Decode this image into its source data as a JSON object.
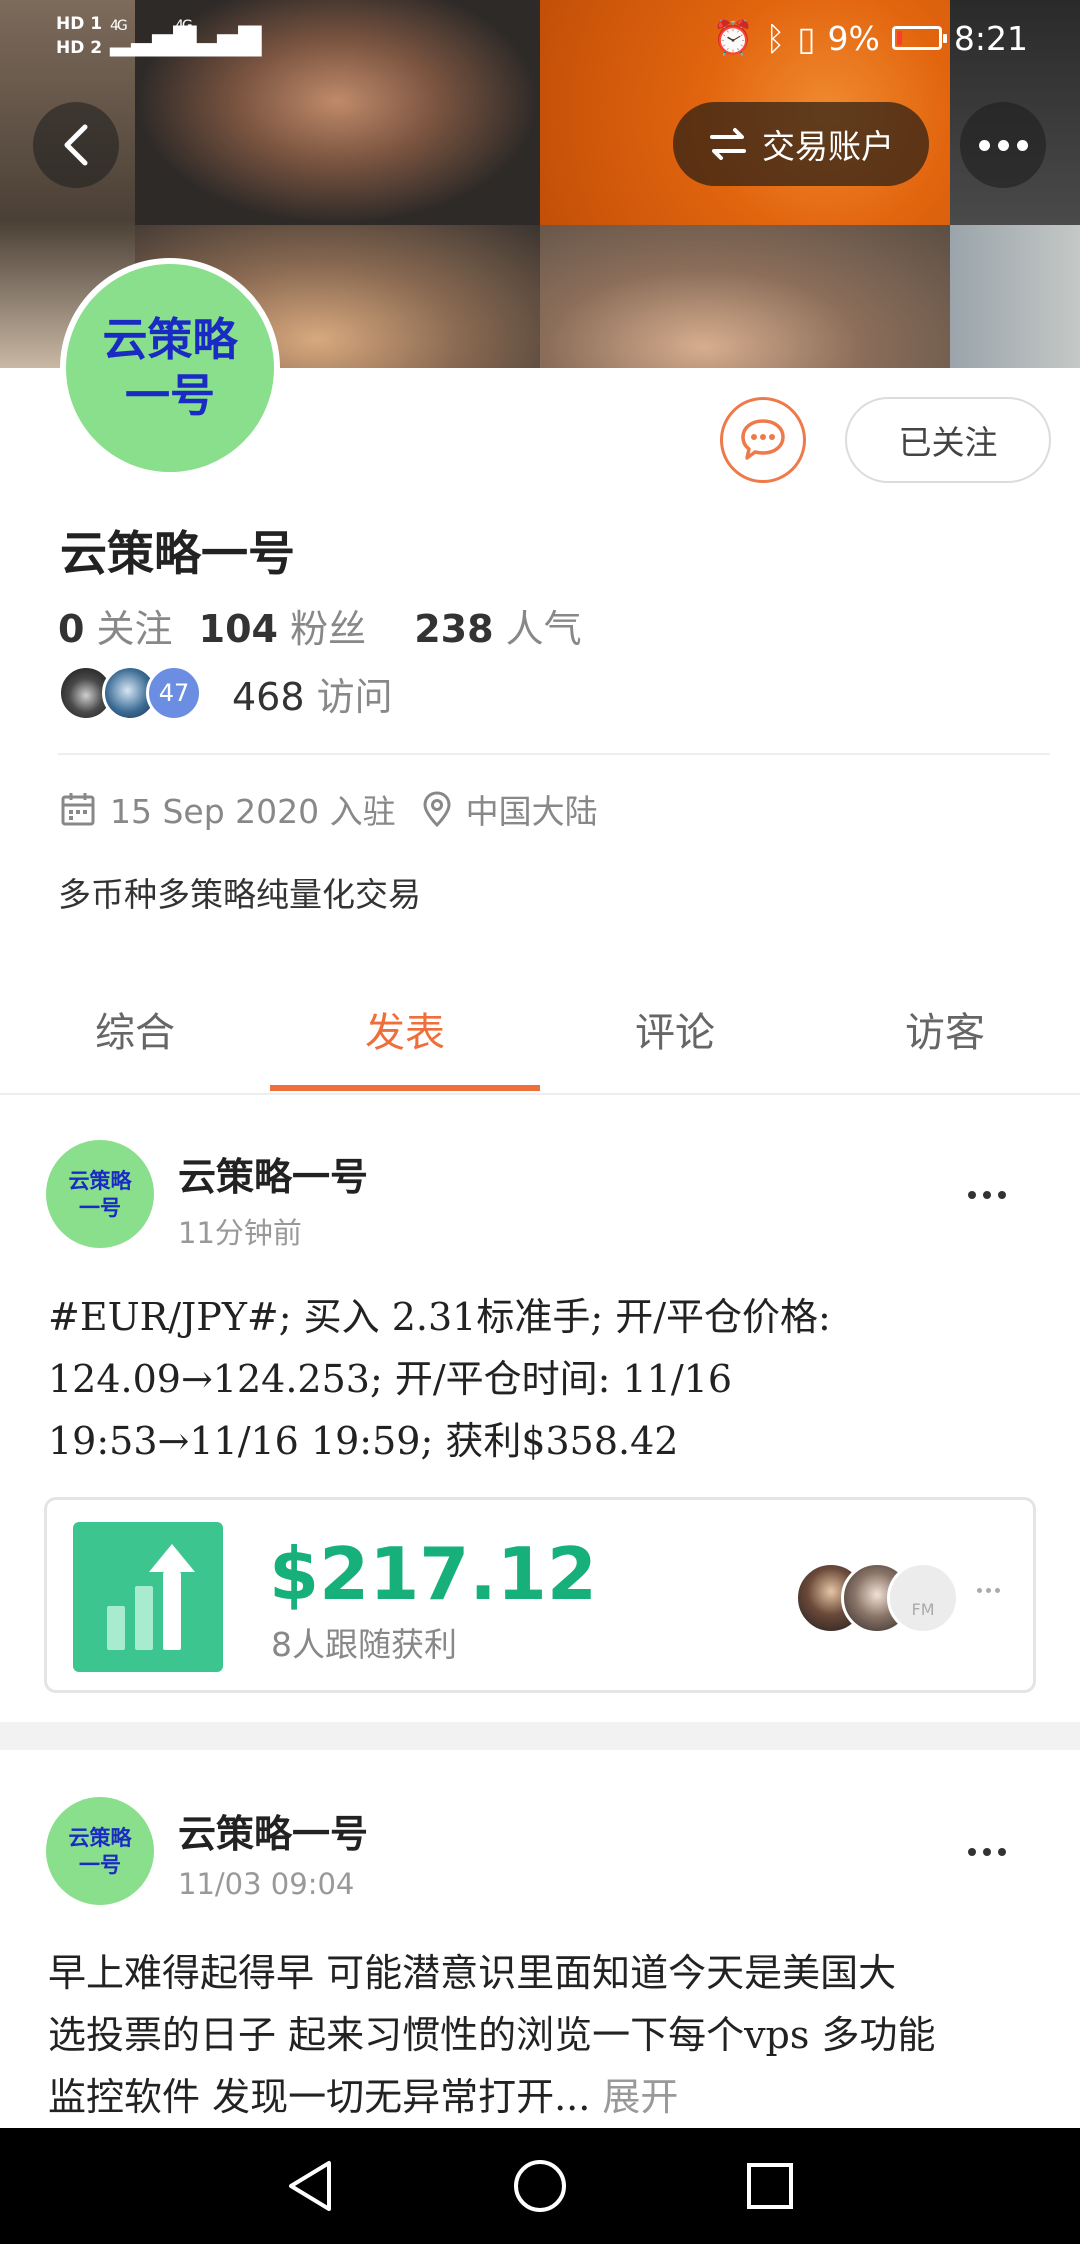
{
  "status_bar": {
    "left_labels": [
      "HD 1",
      "HD 2"
    ],
    "network_1": "4G",
    "network_2": "4G",
    "battery_percent": "9%",
    "time": "8:21"
  },
  "header": {
    "trade_account_label": "交易账户"
  },
  "profile": {
    "avatar_text": "云策略\n一号",
    "name": "云策略一号",
    "follow_button_label": "已关注",
    "following_count": "0",
    "following_label": "关注",
    "followers_count": "104",
    "followers_label": "粉丝",
    "popularity_count": "238",
    "popularity_label": "人气",
    "visitor_badge": "47",
    "visits_count": "468",
    "visits_label": "访问",
    "joined": "15 Sep 2020 入驻",
    "location": "中国大陆",
    "bio": "多币种多策略纯量化交易"
  },
  "tabs": [
    {
      "label": "综合",
      "active": false
    },
    {
      "label": "发表",
      "active": true
    },
    {
      "label": "评论",
      "active": false
    },
    {
      "label": "访客",
      "active": false
    }
  ],
  "posts": [
    {
      "author": "云策略一号",
      "avatar_text": "云策略\n一号",
      "time": "11分钟前",
      "lines": [
        "#EUR/JPY#; 买入 2.31标准手; 开/平仓价格:",
        "124.09→124.253; 开/平仓时间:  11/16",
        "19:53→11/16 19:59; 获利$358.42"
      ],
      "profit_card": {
        "amount": "$217.12",
        "label": "8人跟随获利",
        "follower_badge": "FM"
      }
    },
    {
      "author": "云策略一号",
      "avatar_text": "云策略\n一号",
      "time": "11/03 09:04",
      "lines": [
        "早上难得起得早 可能潜意识里面知道今天是美国大",
        "选投票的日子 起来习惯性的浏览一下每个vps 多功能",
        "监控软件 发现一切无异常打开..."
      ],
      "expand_label": "展开"
    }
  ],
  "colors": {
    "accent": "#ef6f3a",
    "profit_green": "#17b07a",
    "avatar_green": "#89df8b",
    "avatar_text_blue": "#1a2bc4"
  },
  "icons": [
    "back-arrow-icon",
    "swap-icon",
    "more-icon",
    "chat-bubble-icon",
    "calendar-icon",
    "location-pin-icon",
    "bar-chart-up-icon",
    "nav-back-icon",
    "nav-home-icon",
    "nav-recents-icon"
  ]
}
